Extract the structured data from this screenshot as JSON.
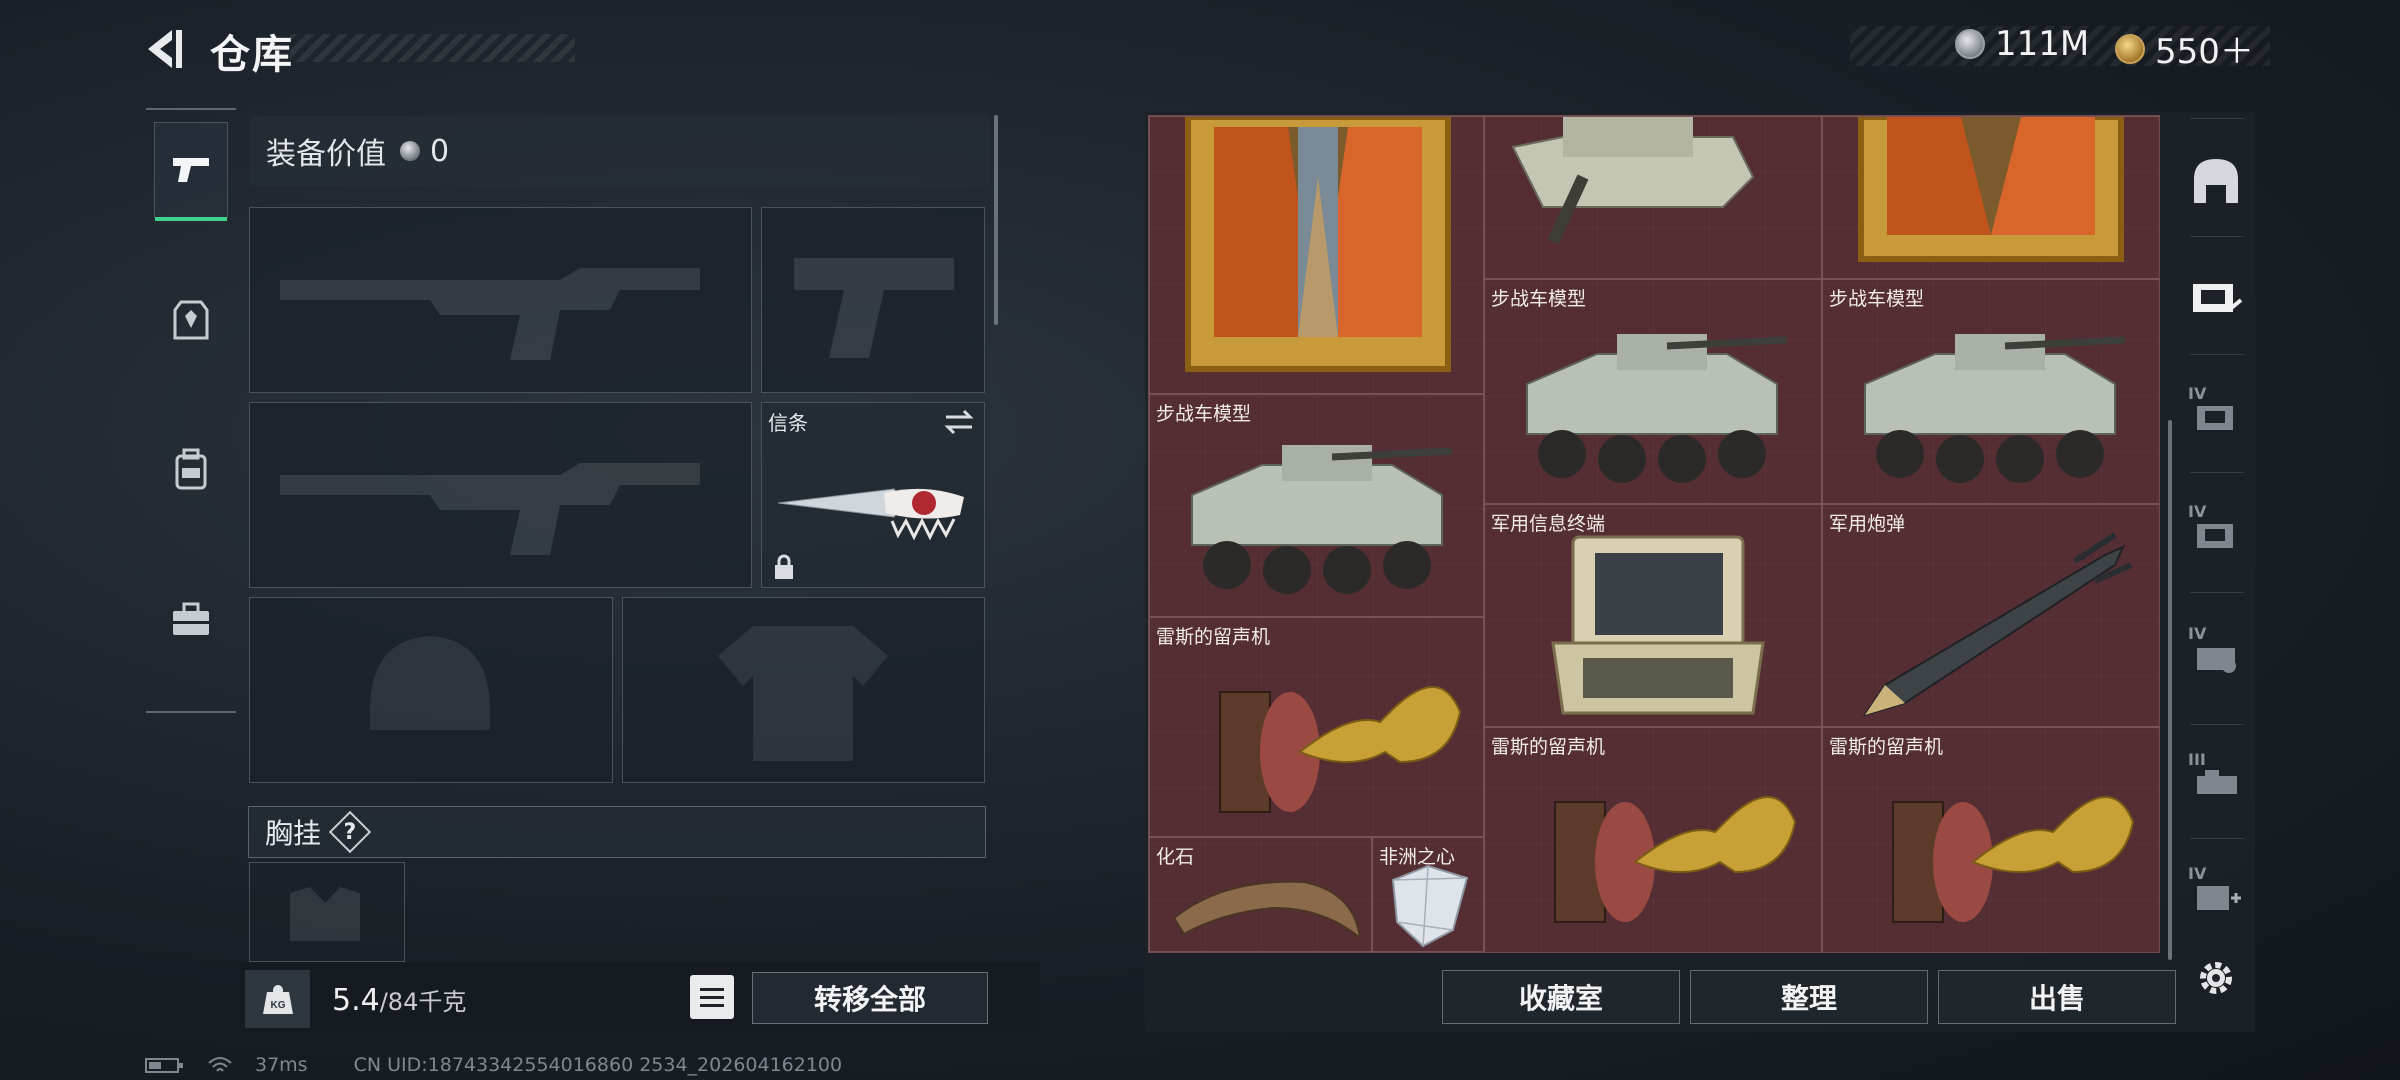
{
  "header": {
    "title": "仓库",
    "currencies": [
      {
        "icon": "silver-coin-icon",
        "value": "111M"
      },
      {
        "icon": "gold-coin-icon",
        "value": "550＋"
      }
    ]
  },
  "left_nav": {
    "items": [
      {
        "icon": "pistol-icon",
        "active": true
      },
      {
        "icon": "armor-icon",
        "active": false
      },
      {
        "icon": "backpack-icon",
        "active": false
      },
      {
        "icon": "briefcase-icon",
        "active": false
      }
    ]
  },
  "loadout": {
    "equip_value_label": "装备价值",
    "equip_value": "0",
    "melee_slot_label": "信条",
    "chest_rig_label": "胸挂",
    "chest_help": "?",
    "weight_value": "5.4",
    "weight_capacity": "/84千克",
    "weight_icon_text": "KG",
    "transfer_all_label": "转移全部"
  },
  "stash": {
    "items": [
      {
        "name": "",
        "type": "painting"
      },
      {
        "name": "",
        "type": "tank"
      },
      {
        "name": "",
        "type": "painting"
      },
      {
        "name": "步战车模型",
        "type": "ifv"
      },
      {
        "name": "步战车模型",
        "type": "ifv"
      },
      {
        "name": "步战车模型",
        "type": "ifv"
      },
      {
        "name": "军用信息终端",
        "type": "terminal"
      },
      {
        "name": "军用炮弹",
        "type": "shell"
      },
      {
        "name": "雷斯的留声机",
        "type": "gramophone"
      },
      {
        "name": "雷斯的留声机",
        "type": "gramophone"
      },
      {
        "name": "雷斯的留声机",
        "type": "gramophone"
      },
      {
        "name": "化石",
        "type": "fossil"
      },
      {
        "name": "非洲之心",
        "type": "diamond"
      }
    ]
  },
  "right_col": {
    "icons": [
      {
        "name": "all-containers-icon",
        "badge": ""
      },
      {
        "name": "case-icon",
        "badge": ""
      },
      {
        "name": "case-iv-icon",
        "badge": "IV"
      },
      {
        "name": "case-iv-2-icon",
        "badge": "IV"
      },
      {
        "name": "case-iv-3-icon",
        "badge": "IV"
      },
      {
        "name": "case-iii-icon",
        "badge": "III"
      },
      {
        "name": "case-iv-add-icon",
        "badge": "IV"
      }
    ]
  },
  "bottom_buttons": {
    "collection": "收藏室",
    "organize": "整理",
    "sell": "出售"
  },
  "status": {
    "ping": "37ms",
    "uid": "CN UID:18743342554016860 2534_202604162100"
  },
  "colors": {
    "accent": "#3fd28f",
    "stash_bg": "#4f2c31"
  }
}
